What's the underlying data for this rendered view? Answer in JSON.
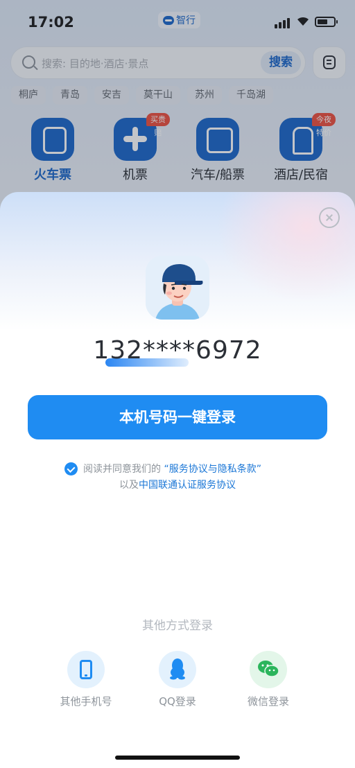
{
  "status_bar": {
    "time": "17:02",
    "brand": "智行"
  },
  "search": {
    "placeholder": "搜索: 目的地·酒店·景点",
    "button": "搜索"
  },
  "chips": [
    "桐庐",
    "青岛",
    "安吉",
    "莫干山",
    "苏州",
    "千岛湖"
  ],
  "categories": [
    {
      "label": "火车票",
      "icon": "train-icon",
      "tag": ""
    },
    {
      "label": "机票",
      "icon": "plane-icon",
      "tag": "买贵赔"
    },
    {
      "label": "汽车/船票",
      "icon": "bus-icon",
      "tag": ""
    },
    {
      "label": "酒店/民宿",
      "icon": "hotel-icon",
      "tag": "今夜特价"
    }
  ],
  "login_sheet": {
    "phone": "132****6972",
    "login_button": "本机号码一键登录",
    "agree_prefix": "阅读并同意我们的",
    "agree_link1": "“服务协议与隐私条款”",
    "agree_prefix2": "以及",
    "agree_link2": "中国联通认证服务协议",
    "agreed": true,
    "other_title": "其他方式登录",
    "options": [
      {
        "label": "其他手机号",
        "icon": "mobile-phone-icon",
        "color": "#1f8cf2"
      },
      {
        "label": "QQ登录",
        "icon": "qq-icon",
        "color": "#1f8cf2"
      },
      {
        "label": "微信登录",
        "icon": "wechat-icon",
        "color": "#2bb55c"
      }
    ]
  },
  "colors": {
    "accent": "#1f8cf2",
    "brand_blue": "#1a66c9",
    "tag_red": "#ee4e3d"
  }
}
